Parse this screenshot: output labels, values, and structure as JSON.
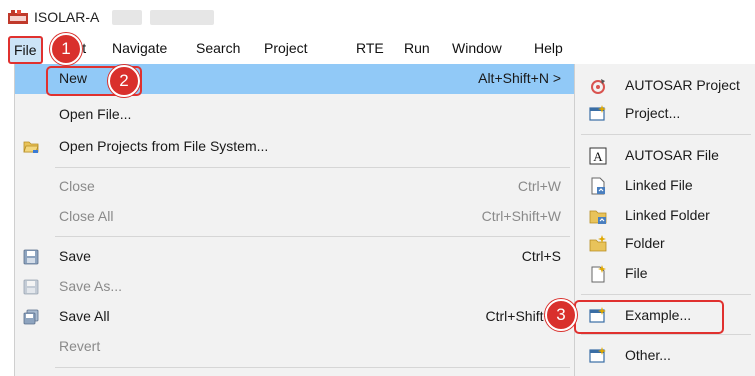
{
  "window": {
    "title": "ISOLAR-A"
  },
  "menubar": {
    "items": [
      "File",
      "Edit",
      "Navigate",
      "Search",
      "Project",
      "RTE",
      "Run",
      "Window",
      "Help"
    ]
  },
  "file_menu": {
    "items": [
      {
        "label": "New",
        "accelerator": "Alt+Shift+N >",
        "icon": "none",
        "enabled": true,
        "highlighted": true
      },
      {
        "label": "Open File...",
        "accelerator": "",
        "icon": "none",
        "enabled": true
      },
      {
        "label": "Open Projects from File System...",
        "accelerator": "",
        "icon": "folder-open-icon",
        "enabled": true
      },
      {
        "label": "Close",
        "accelerator": "Ctrl+W",
        "icon": "none",
        "enabled": false
      },
      {
        "label": "Close All",
        "accelerator": "Ctrl+Shift+W",
        "icon": "none",
        "enabled": false
      },
      {
        "label": "Save",
        "accelerator": "Ctrl+S",
        "icon": "save-icon",
        "enabled": true
      },
      {
        "label": "Save As...",
        "accelerator": "",
        "icon": "save-as-icon",
        "enabled": false
      },
      {
        "label": "Save All",
        "accelerator": "Ctrl+Shift+S",
        "icon": "save-all-icon",
        "enabled": true
      },
      {
        "label": "Revert",
        "accelerator": "",
        "icon": "none",
        "enabled": false
      }
    ]
  },
  "new_submenu": {
    "items": [
      {
        "label": "AUTOSAR Project",
        "icon": "autosar-project-icon"
      },
      {
        "label": "Project...",
        "icon": "project-icon"
      },
      {
        "label": "AUTOSAR File",
        "icon": "autosar-file-icon"
      },
      {
        "label": "Linked File",
        "icon": "linked-file-icon"
      },
      {
        "label": "Linked Folder",
        "icon": "linked-folder-icon"
      },
      {
        "label": "Folder",
        "icon": "folder-icon"
      },
      {
        "label": "File",
        "icon": "file-icon"
      },
      {
        "label": "Example...",
        "icon": "example-icon"
      },
      {
        "label": "Other...",
        "icon": "other-icon"
      }
    ]
  },
  "annotations": {
    "steps": [
      "1",
      "2",
      "3"
    ],
    "color": "#d9302c"
  },
  "colors": {
    "highlight": "#91c9f7",
    "menu_background": "#f2f2f2",
    "disabled_text": "#8a8a8a"
  }
}
